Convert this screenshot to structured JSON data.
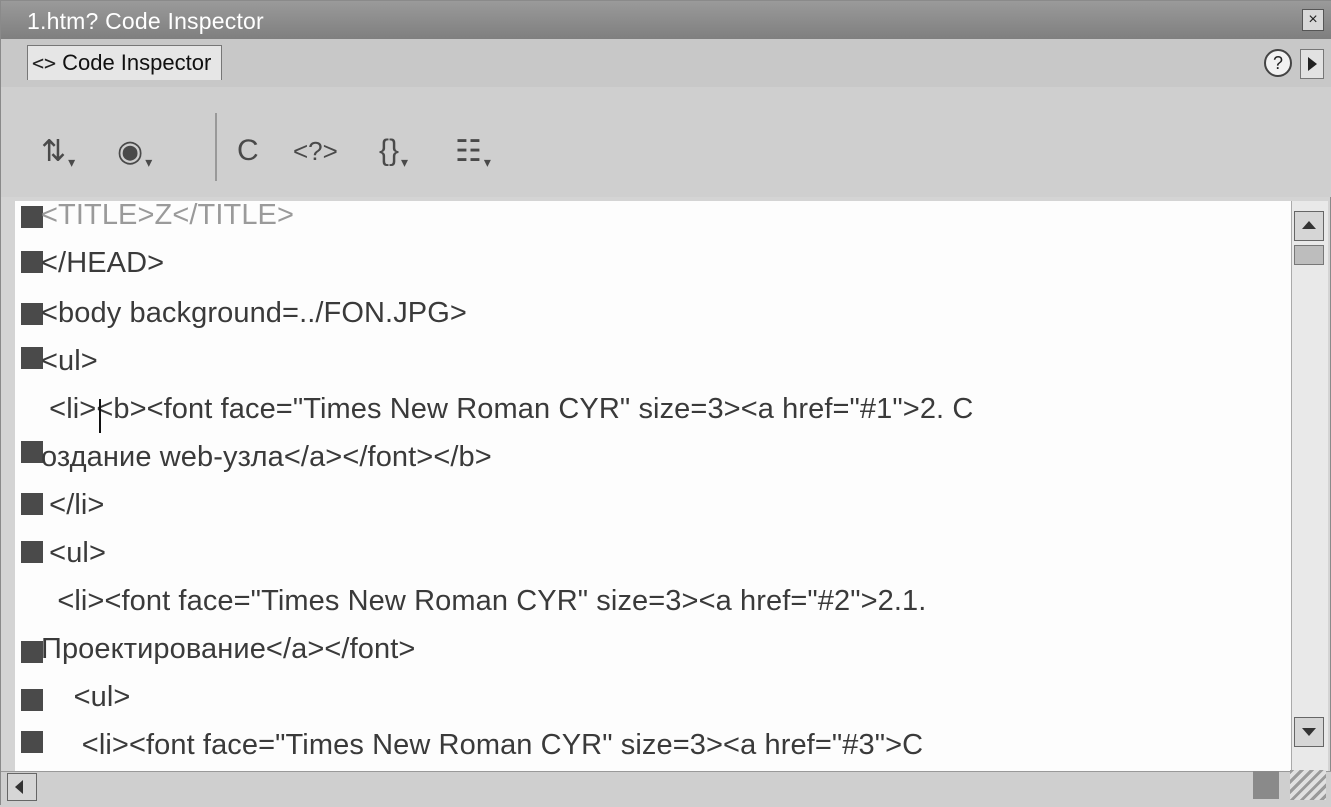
{
  "window": {
    "title": "1.htm? Code Inspector",
    "close_symbol": "×"
  },
  "panel": {
    "tab_icon": "<>",
    "tab_label": "Code Inspector",
    "help_symbol": "?"
  },
  "toolbar": {
    "tools": [
      {
        "name": "file-management-icon",
        "glyph": "⇅"
      },
      {
        "name": "preview-globe-icon",
        "glyph": "◉"
      },
      {
        "name": "refresh-icon",
        "glyph": "C"
      },
      {
        "name": "reference-icon",
        "glyph": "<?>"
      },
      {
        "name": "code-navigation-icon",
        "glyph": "{}"
      },
      {
        "name": "view-options-icon",
        "glyph": "☷"
      }
    ]
  },
  "code_lines": [
    "<TITLE>Z</TITLE>",
    "</HEAD>",
    "<body background=../FON.JPG>",
    "<ul>",
    " <li><b><font face=\"Times New Roman CYR\" size=3><a href=\"#1\">2. C",
    "оздание web-узла</a></font></b>",
    " </li>",
    " <ul>",
    "  <li><font face=\"Times New Roman CYR\" size=3><a href=\"#2\">2.1.",
    "Проектирование</a></font>",
    "    <ul>",
    "     <li><font face=\"Times New Roman CYR\" size=3><a href=\"#3\">C"
  ]
}
